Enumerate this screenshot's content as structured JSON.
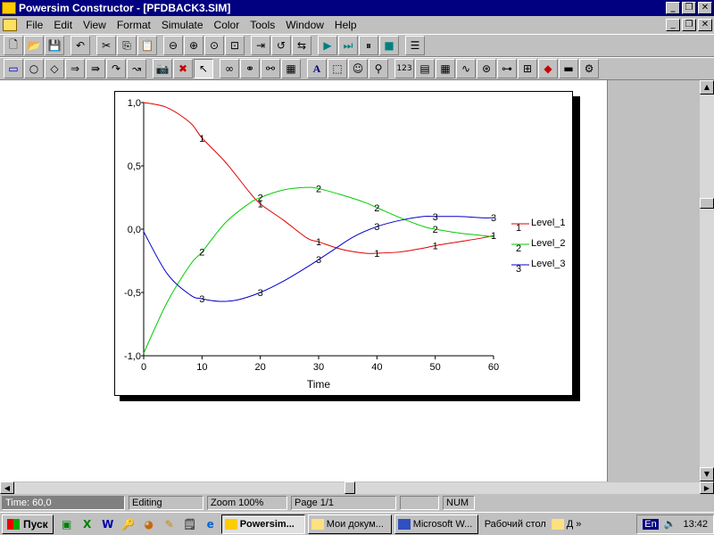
{
  "window": {
    "title": "Powersim Constructor - [PFDBACK3.SIM]"
  },
  "menu": [
    "File",
    "Edit",
    "View",
    "Format",
    "Simulate",
    "Color",
    "Tools",
    "Window",
    "Help"
  ],
  "toolbar1": [
    "new-icon",
    "open-icon",
    "save-icon",
    "undo-icon",
    "cut-icon",
    "copy-icon",
    "paste-icon",
    "zoom-out-icon",
    "zoom-in-icon",
    "zoom-reset-icon",
    "zoom-fit-icon",
    "step-icon",
    "reset-icon",
    "compile-icon",
    "run-icon",
    "run-step-icon",
    "pause-icon",
    "stop-icon",
    "properties-icon"
  ],
  "toolbar2": [
    "level-icon",
    "auxiliary-icon",
    "constant-icon",
    "flow-icon",
    "flow-with-rate-icon",
    "link-icon",
    "delayed-link-icon",
    "snapshot-icon",
    "delete-icon",
    "pointer-icon",
    "chain-icon",
    "chain-alt-icon",
    "chain-alt2-icon",
    "blocks-icon",
    "text-icon",
    "frame-icon",
    "picture-icon",
    "probe-icon",
    "number-icon",
    "table-icon",
    "grid-icon",
    "graph-icon",
    "scatter-icon",
    "switch-icon",
    "slider-icon",
    "diamond-icon",
    "button-icon",
    "gears-icon"
  ],
  "chart_data": {
    "type": "line",
    "xlabel": "Time",
    "ylabel": "",
    "xlim": [
      0,
      60
    ],
    "ylim": [
      -1.0,
      1.0
    ],
    "xticks": [
      "0",
      "10",
      "20",
      "30",
      "40",
      "50",
      "60"
    ],
    "yticks": [
      "-1,0",
      "-0,5",
      "0,0",
      "0,5",
      "1,0"
    ],
    "legend_position": "right",
    "series": [
      {
        "name": "Level_1",
        "marker": "1",
        "color": "#e00000",
        "x": [
          0,
          4,
          8,
          10,
          14,
          18,
          20,
          24,
          28,
          30,
          34,
          38,
          40,
          44,
          48,
          50,
          54,
          58,
          60
        ],
        "y": [
          1.0,
          0.96,
          0.84,
          0.72,
          0.53,
          0.3,
          0.2,
          0.07,
          -0.07,
          -0.1,
          -0.16,
          -0.19,
          -0.19,
          -0.18,
          -0.15,
          -0.13,
          -0.1,
          -0.07,
          -0.05
        ],
        "markers_at": [
          10,
          20,
          30,
          40,
          50,
          60
        ]
      },
      {
        "name": "Level_2",
        "marker": "2",
        "color": "#00cc00",
        "x": [
          0,
          4,
          8,
          10,
          14,
          18,
          20,
          24,
          28,
          30,
          34,
          38,
          40,
          44,
          48,
          50,
          54,
          58,
          60
        ],
        "y": [
          -0.98,
          -0.58,
          -0.28,
          -0.18,
          0.05,
          0.2,
          0.25,
          0.31,
          0.33,
          0.32,
          0.27,
          0.21,
          0.17,
          0.09,
          0.02,
          -0.0,
          -0.03,
          -0.05,
          -0.06
        ],
        "markers_at": [
          10,
          20,
          30,
          40,
          50
        ]
      },
      {
        "name": "Level_3",
        "marker": "3",
        "color": "#0000cc",
        "x": [
          0,
          4,
          8,
          10,
          13,
          16,
          20,
          24,
          28,
          32,
          36,
          40,
          44,
          48,
          50,
          54,
          58,
          60
        ],
        "y": [
          -0.02,
          -0.35,
          -0.52,
          -0.55,
          -0.57,
          -0.56,
          -0.5,
          -0.41,
          -0.3,
          -0.18,
          -0.06,
          0.02,
          0.07,
          0.1,
          0.1,
          0.1,
          0.09,
          0.09
        ],
        "markers_at": [
          10,
          20,
          30,
          40,
          50,
          60
        ]
      }
    ]
  },
  "status": {
    "time": "Time: 60,0",
    "mode": "Editing",
    "zoom": "Zoom 100%",
    "page": "Page  1/1",
    "blank": "",
    "num": "NUM"
  },
  "taskbar": {
    "start": "Пуск",
    "quicklaunch": [
      "desktop-icon",
      "excel-icon",
      "word-icon",
      "access-icon",
      "powerpoint-icon",
      "pencil-icon",
      "notepad-icon",
      "ie-icon"
    ],
    "tasks": [
      {
        "label": "Powersim...",
        "active": true
      },
      {
        "label": "Мои докум...",
        "active": false
      },
      {
        "label": "Microsoft W...",
        "active": false
      }
    ],
    "desktop": "Рабочий стол",
    "folder": "Д",
    "lang": "En",
    "clock": "13:42"
  }
}
